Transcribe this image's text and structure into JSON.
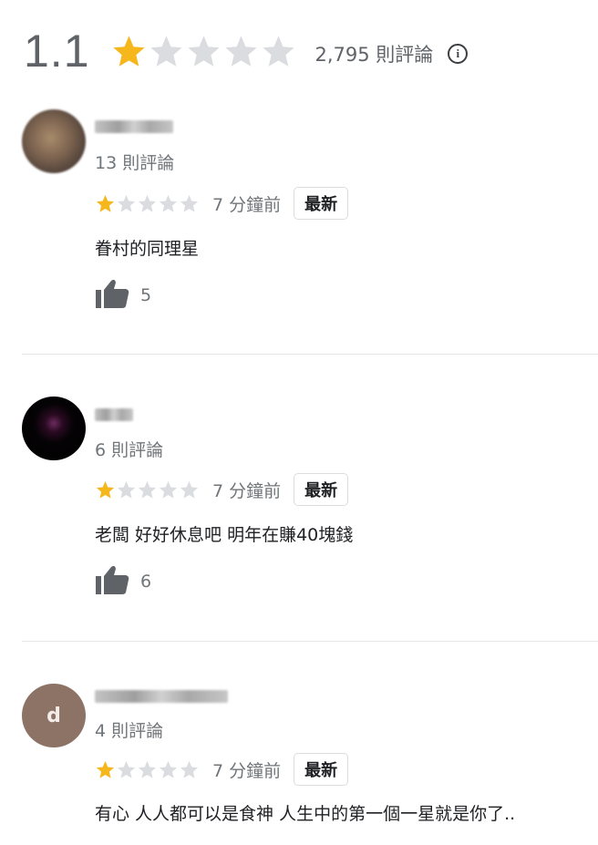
{
  "summary": {
    "average": "1.1",
    "rating": 1,
    "max_rating": 5,
    "total_reviews": "2,795 則評論",
    "info_icon": "info-icon"
  },
  "colors": {
    "star_filled": "#f5b71c",
    "star_empty": "#dadce0",
    "like_icon": "#5f6368"
  },
  "reviews": [
    {
      "review_count": "13 則評論",
      "rating": 1,
      "time": "7 分鐘前",
      "badge": "最新",
      "text": "眷村的同理星",
      "likes": "5"
    },
    {
      "review_count": "6 則評論",
      "rating": 1,
      "time": "7 分鐘前",
      "badge": "最新",
      "text": "老闆 好好休息吧 明年在賺40塊錢",
      "likes": "6"
    },
    {
      "avatar_letter": "d",
      "review_count": "4 則評論",
      "rating": 1,
      "time": "7 分鐘前",
      "badge": "最新",
      "text": "有心 人人都可以是食神 人生中的第一個一星就是你了.."
    }
  ]
}
